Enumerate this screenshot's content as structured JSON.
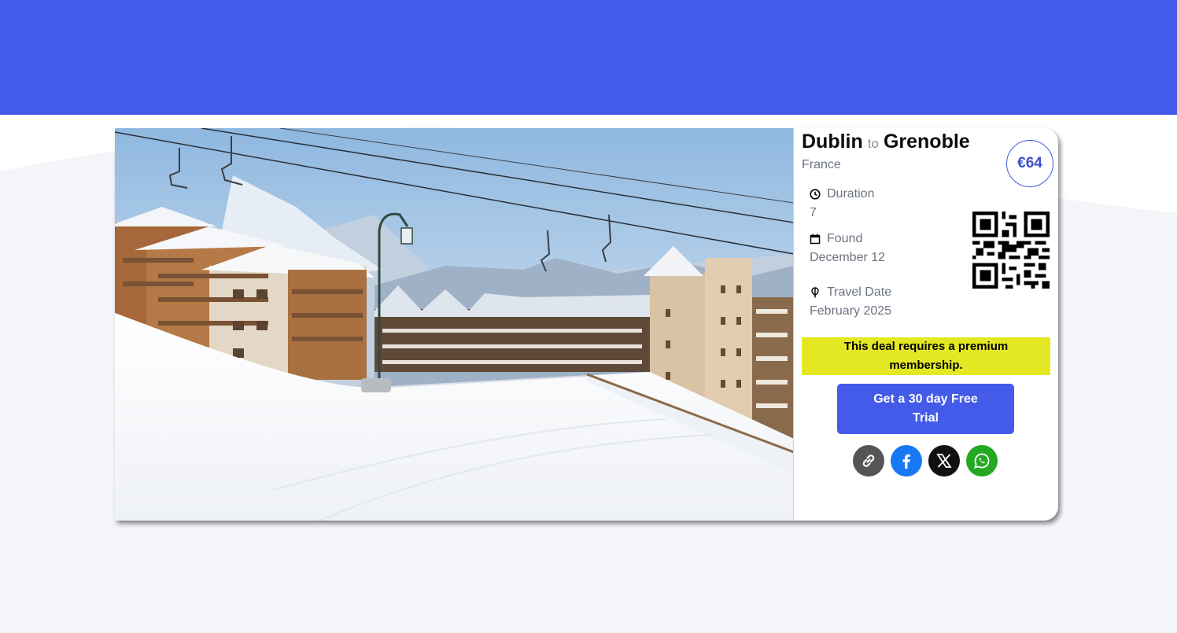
{
  "deal": {
    "origin": "Dublin",
    "to_word": "to",
    "destination": "Grenoble",
    "country": "France",
    "price": "€64",
    "duration_label": "Duration",
    "duration_value": "7",
    "found_label": "Found",
    "found_value": "December 12",
    "travel_label": "Travel Date",
    "travel_value": "February 2025",
    "photo_alt": "Snowy ski resort with chalets and chairlift",
    "qr_icon": "qr-code"
  },
  "premium": {
    "notice": "This deal requires a premium membership.",
    "trial_button": "Get a 30 day Free Trial"
  },
  "share": {
    "buttons": [
      {
        "icon": "link-icon",
        "color": "#555555"
      },
      {
        "icon": "facebook-icon",
        "color": "#1877f2"
      },
      {
        "icon": "x-icon",
        "color": "#111111"
      },
      {
        "icon": "whatsapp-icon",
        "color": "#25a822"
      }
    ]
  },
  "theme": {
    "accent": "#435be8",
    "banner": "#e4e822",
    "background": "#f4f4f9"
  }
}
